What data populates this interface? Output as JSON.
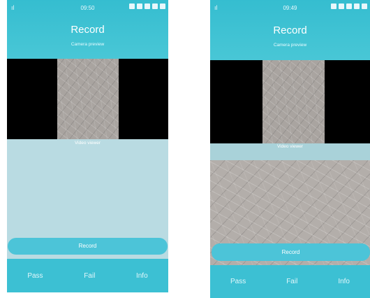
{
  "colors": {
    "accent": "#3cc0d3",
    "button": "#4cc4d8",
    "panel": "#b8dde4"
  },
  "screens": [
    {
      "status_time": "09:50",
      "title": "Record",
      "camera_preview_label": "Camera preview",
      "video_viewer_label": "Video viewer",
      "record_label": "Record",
      "pass_label": "Pass",
      "fail_label": "Fail",
      "info_label": "Info"
    },
    {
      "status_time": "09:49",
      "title": "Record",
      "camera_preview_label": "Camera preview",
      "video_viewer_label": "Video viewer",
      "record_label": "Record",
      "pass_label": "Pass",
      "fail_label": "Fail",
      "info_label": "Info"
    }
  ]
}
